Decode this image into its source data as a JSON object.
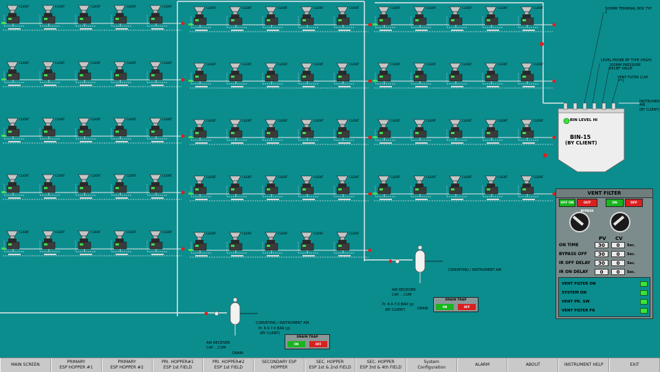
{
  "colors": {
    "background": "#0b8d8e",
    "pipe_white": "#e8e8e8",
    "pipe_green": "#3ee04a",
    "valve_red": "#e11d1d",
    "hopper_dark": "#2a2a2a",
    "hopper_grey": "#c6c6c6",
    "led_green": "#38e63b",
    "nav_bg": "#c9c9c9"
  },
  "diagram": {
    "hopper_label": "CLIENT",
    "module_caption_1": "ESP/OUTLET/MODULE",
    "module_caption_2": "FEEDING SYSTEM",
    "bin": {
      "name": "BIN-15",
      "owner": "(BY CLIENT)",
      "level_indicator": "BIN LEVEL HI"
    },
    "bin_callouts": [
      "500MM TERMINAL BOX TYP 2",
      "LEVEL PROBE RF TYPE (HIGH)",
      "200MM PRESSURE RELIEF VALVE",
      "VENT FILTER (CAP. ***)",
      "INSTRUMENT AIR",
      "(BY CLIENT)"
    ],
    "air_receiver_1": {
      "label": "AIR RECEIVER",
      "cap": "CAP. ...CUM",
      "line": "CONVEYING / INSTRUMENT AIR",
      "pressure": "Pr. 6.0-7.0 BAR (g)",
      "by": "(BY CLIENT)",
      "drain": "DRAIN"
    },
    "air_receiver_2": {
      "label": "AIR RECEIVER",
      "cap": "CAP. ...CUM",
      "line": "CONVEYING / INSTRUMENT AIR",
      "pressure": "Pr. 6.0-7.0 BAR (g)",
      "by": "(BY CLIENT)",
      "drain": "DRAIN"
    },
    "drain_trap_1": {
      "title": "DRAIN TRAP",
      "on": "ON",
      "off": "OFF"
    },
    "drain_trap_2": {
      "title": "DRAIN TRAP",
      "on": "ON",
      "off": "OFF"
    }
  },
  "vent_filter": {
    "title": "VENT FILTER",
    "btn_off_1": "OFF ON",
    "btn_bypass": "OUT BYPASS",
    "btn_on": "ON",
    "btn_off_2": "OFF",
    "col_pv": "PV",
    "col_cv": "CV",
    "rows": [
      {
        "label": "ON TIME",
        "pv": "30",
        "cv": "0",
        "unit": "Sec."
      },
      {
        "label": "BYPASS OFF",
        "pv": "30",
        "cv": "0",
        "unit": "Sec."
      },
      {
        "label": "IR OFF DELAY",
        "pv": "30",
        "cv": "0",
        "unit": "Sec."
      },
      {
        "label": "IR ON DELAY",
        "pv": "0",
        "cv": "0",
        "unit": "Sec."
      }
    ],
    "status": [
      {
        "label": "VENT FILTER ON",
        "state": "on"
      },
      {
        "label": "SYSTEM ON",
        "state": "on"
      },
      {
        "label": "VENT PR. SW",
        "state": "on"
      },
      {
        "label": "VENT FILTER FR",
        "state": "on"
      }
    ]
  },
  "nav": [
    {
      "line1": "MAIN SCREEN",
      "line2": ""
    },
    {
      "line1": "PRIMARY",
      "line2": "ESP HOPPER #1"
    },
    {
      "line1": "PRIMARY",
      "line2": "ESP HOPPER #2"
    },
    {
      "line1": "PRI. HOPPER#1",
      "line2": "ESP 1st FIELD"
    },
    {
      "line1": "PRI. HOPPER#2",
      "line2": "ESP 1st FIELD"
    },
    {
      "line1": "SECONDARY ESP",
      "line2": "HOPPER"
    },
    {
      "line1": "SEC. HOPPER",
      "line2": "ESP 1st & 2nd FIELD"
    },
    {
      "line1": "SEC. HOPPER",
      "line2": "ESP 3rd & 4th FIELD"
    },
    {
      "line1": "System",
      "line2": "Configuration"
    },
    {
      "line1": "ALARM",
      "line2": ""
    },
    {
      "line1": "ABOUT",
      "line2": ""
    },
    {
      "line1": "INSTRUMENT HELP",
      "line2": ""
    },
    {
      "line1": "EXIT",
      "line2": ""
    }
  ]
}
